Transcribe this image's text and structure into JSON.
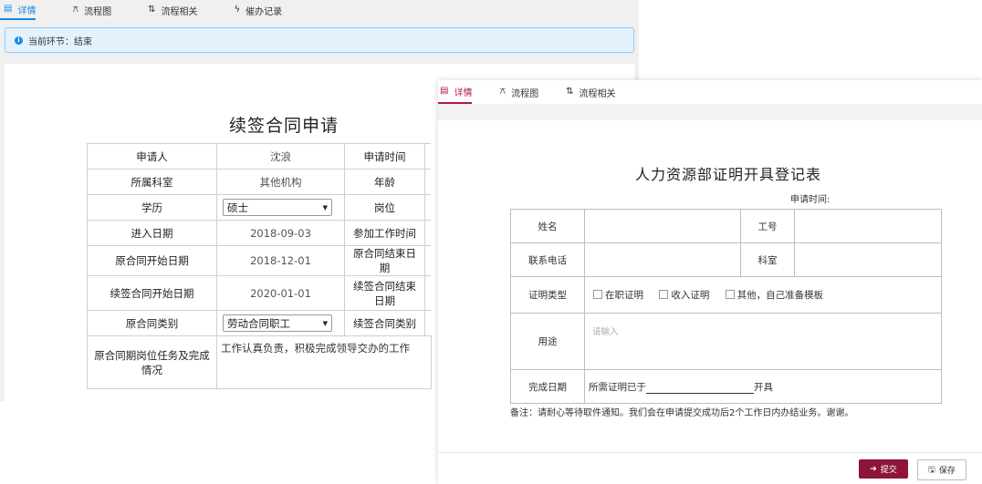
{
  "back": {
    "tabs": [
      {
        "icon": "details-icon",
        "label": "详情"
      },
      {
        "icon": "flowchart-icon",
        "label": "流程图"
      },
      {
        "icon": "process-related-icon",
        "label": "流程相关"
      },
      {
        "icon": "urge-record-icon",
        "label": "催办记录"
      }
    ],
    "notice": "当前环节：结束",
    "form_title": "续签合同申请",
    "rows": [
      {
        "l1": "申请人",
        "v1": "沈浪",
        "l2": "申请时间"
      },
      {
        "l1": "所属科室",
        "v1": "其他机构",
        "l2": "年龄"
      },
      {
        "l1": "学历",
        "v1": "硕士",
        "l2": "岗位"
      },
      {
        "l1": "进入日期",
        "v1": "2018-09-03",
        "l2": "参加工作时间"
      },
      {
        "l1": "原合同开始日期",
        "v1": "2018-12-01",
        "l2": "原合同结束日期"
      },
      {
        "l1": "续签合同开始日期",
        "v1": "2020-01-01",
        "l2": "续签合同结束日期"
      },
      {
        "l1": "原合同类别",
        "v1": "劳动合同职工",
        "l2": "续签合同类别"
      },
      {
        "l1": "原合同期岗位任务及完成情况",
        "v1": "工作认真负责，积极完成领导交办的工作"
      }
    ]
  },
  "front": {
    "tabs": [
      {
        "icon": "details-icon",
        "label": "详情"
      },
      {
        "icon": "flowchart-icon",
        "label": "流程图"
      },
      {
        "icon": "process-related-icon",
        "label": "流程相关"
      }
    ],
    "form_title": "人力资源部证明开具登记表",
    "apply_time_label": "申请时间:",
    "name_label": "姓名",
    "job_no_label": "工号",
    "phone_label": "联系电话",
    "dept_label": "科室",
    "cert_type_label": "证明类型",
    "cert_options": [
      "在职证明",
      "收入证明",
      "其他，自己准备模板"
    ],
    "purpose_label": "用途",
    "purpose_placeholder": "请输入",
    "finish_date_label": "完成日期",
    "finish_prefix": "所需证明已于",
    "finish_suffix": "开具",
    "note": "备注：请耐心等待取件通知。我们会在申请提交成功后2个工作日内办结业务。谢谢。",
    "submit_label": "提交",
    "save_label": "保存"
  },
  "colors": {
    "back_accent": "#1e88e5",
    "front_accent": "#b0194a",
    "submit_bg": "#8e1537"
  }
}
